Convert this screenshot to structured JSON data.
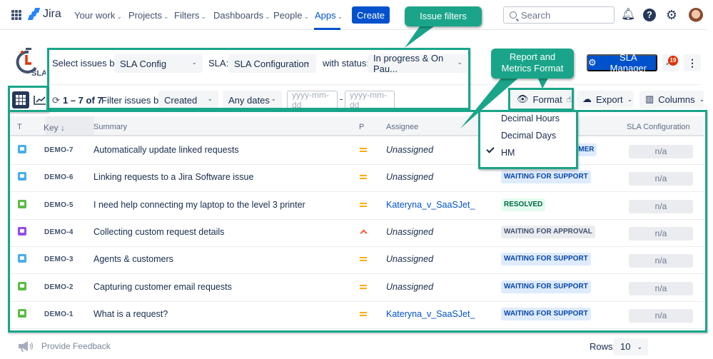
{
  "topnav": {
    "brand": "Jira",
    "items": [
      "Your work",
      "Projects",
      "Filters",
      "Dashboards",
      "People",
      "Apps"
    ],
    "active_item": "Apps",
    "create_label": "Create",
    "search_placeholder": "Search",
    "icons": [
      "app-switcher-icon",
      "notifications-icon",
      "help-icon",
      "settings-icon",
      "avatar"
    ]
  },
  "callouts": {
    "issue_filters": "Issue filters",
    "report_format": "Report and Metrics Format",
    "accent_color": "#1aa58a"
  },
  "app": {
    "logo_text": "SLA",
    "sla_manager_label": "SLA Manager",
    "notification_count": "19"
  },
  "filters": {
    "select_by_label": "Select issues by:",
    "select_by_value": "SLA Config",
    "sla_label": "SLA:",
    "sla_value": "SLA Configuration",
    "status_label": "with status:",
    "status_value": "In progress & On Pau...",
    "count_text": "1 – 7 of 7",
    "filter_by_label": "Filter issues by:",
    "filter_by_value": "Created",
    "dates_value": "Any dates",
    "date_from_placeholder": "yyyy-mm-dd",
    "date_to_placeholder": "yyyy-mm-dd",
    "date_separator": "-"
  },
  "toolbar": {
    "format_label": "Format",
    "export_label": "Export",
    "columns_label": "Columns"
  },
  "format_menu": {
    "items": [
      "Decimal Hours",
      "Decimal Days",
      "HM"
    ],
    "selected": "HM"
  },
  "table": {
    "headers": {
      "type": "T",
      "key": "Key ↓",
      "summary": "Summary",
      "priority": "P",
      "assignee": "Assignee",
      "sla": "SLA Configuration"
    },
    "rows": [
      {
        "type": "service-request",
        "type_color": "#4bade8",
        "key": "DEMO-7",
        "summary": "Automatically update linked requests",
        "priority": "medium",
        "assignee": "Unassigned",
        "status": "WAITING FOR CUSTOMER",
        "status_style": "blue",
        "sla": "n/a"
      },
      {
        "type": "service-request",
        "type_color": "#4bade8",
        "key": "DEMO-6",
        "summary": "Linking requests to a Jira Software issue",
        "priority": "medium",
        "assignee": "Unassigned",
        "status": "WAITING FOR SUPPORT",
        "status_style": "blue",
        "sla": "n/a"
      },
      {
        "type": "incident",
        "type_color": "#5dbb46",
        "key": "DEMO-5",
        "summary": "I need help connecting my laptop to the level 3 printer",
        "priority": "medium",
        "assignee": "Kateryna_v_SaaSJet_",
        "status": "RESOLVED",
        "status_style": "green",
        "sla": "n/a"
      },
      {
        "type": "change",
        "type_color": "#904ee2",
        "key": "DEMO-4",
        "summary": "Collecting custom request details",
        "priority": "high",
        "assignee": "Unassigned",
        "status": "WAITING FOR APPROVAL",
        "status_style": "gray",
        "sla": "n/a"
      },
      {
        "type": "service-request",
        "type_color": "#4bade8",
        "key": "DEMO-3",
        "summary": "Agents & customers",
        "priority": "medium",
        "assignee": "Unassigned",
        "status": "WAITING FOR SUPPORT",
        "status_style": "blue",
        "sla": "n/a"
      },
      {
        "type": "incident",
        "type_color": "#5dbb46",
        "key": "DEMO-2",
        "summary": "Capturing customer email requests",
        "priority": "medium",
        "assignee": "Unassigned",
        "status": "WAITING FOR SUPPORT",
        "status_style": "blue",
        "sla": "n/a"
      },
      {
        "type": "incident",
        "type_color": "#5dbb46",
        "key": "DEMO-1",
        "summary": "What is a request?",
        "priority": "medium",
        "assignee": "Kateryna_v_SaaSJet_",
        "status": "WAITING FOR SUPPORT",
        "status_style": "blue",
        "sla": "n/a"
      }
    ]
  },
  "footer": {
    "feedback_label": "Provide Feedback",
    "rows_label": "Rows:",
    "rows_value": "10"
  }
}
